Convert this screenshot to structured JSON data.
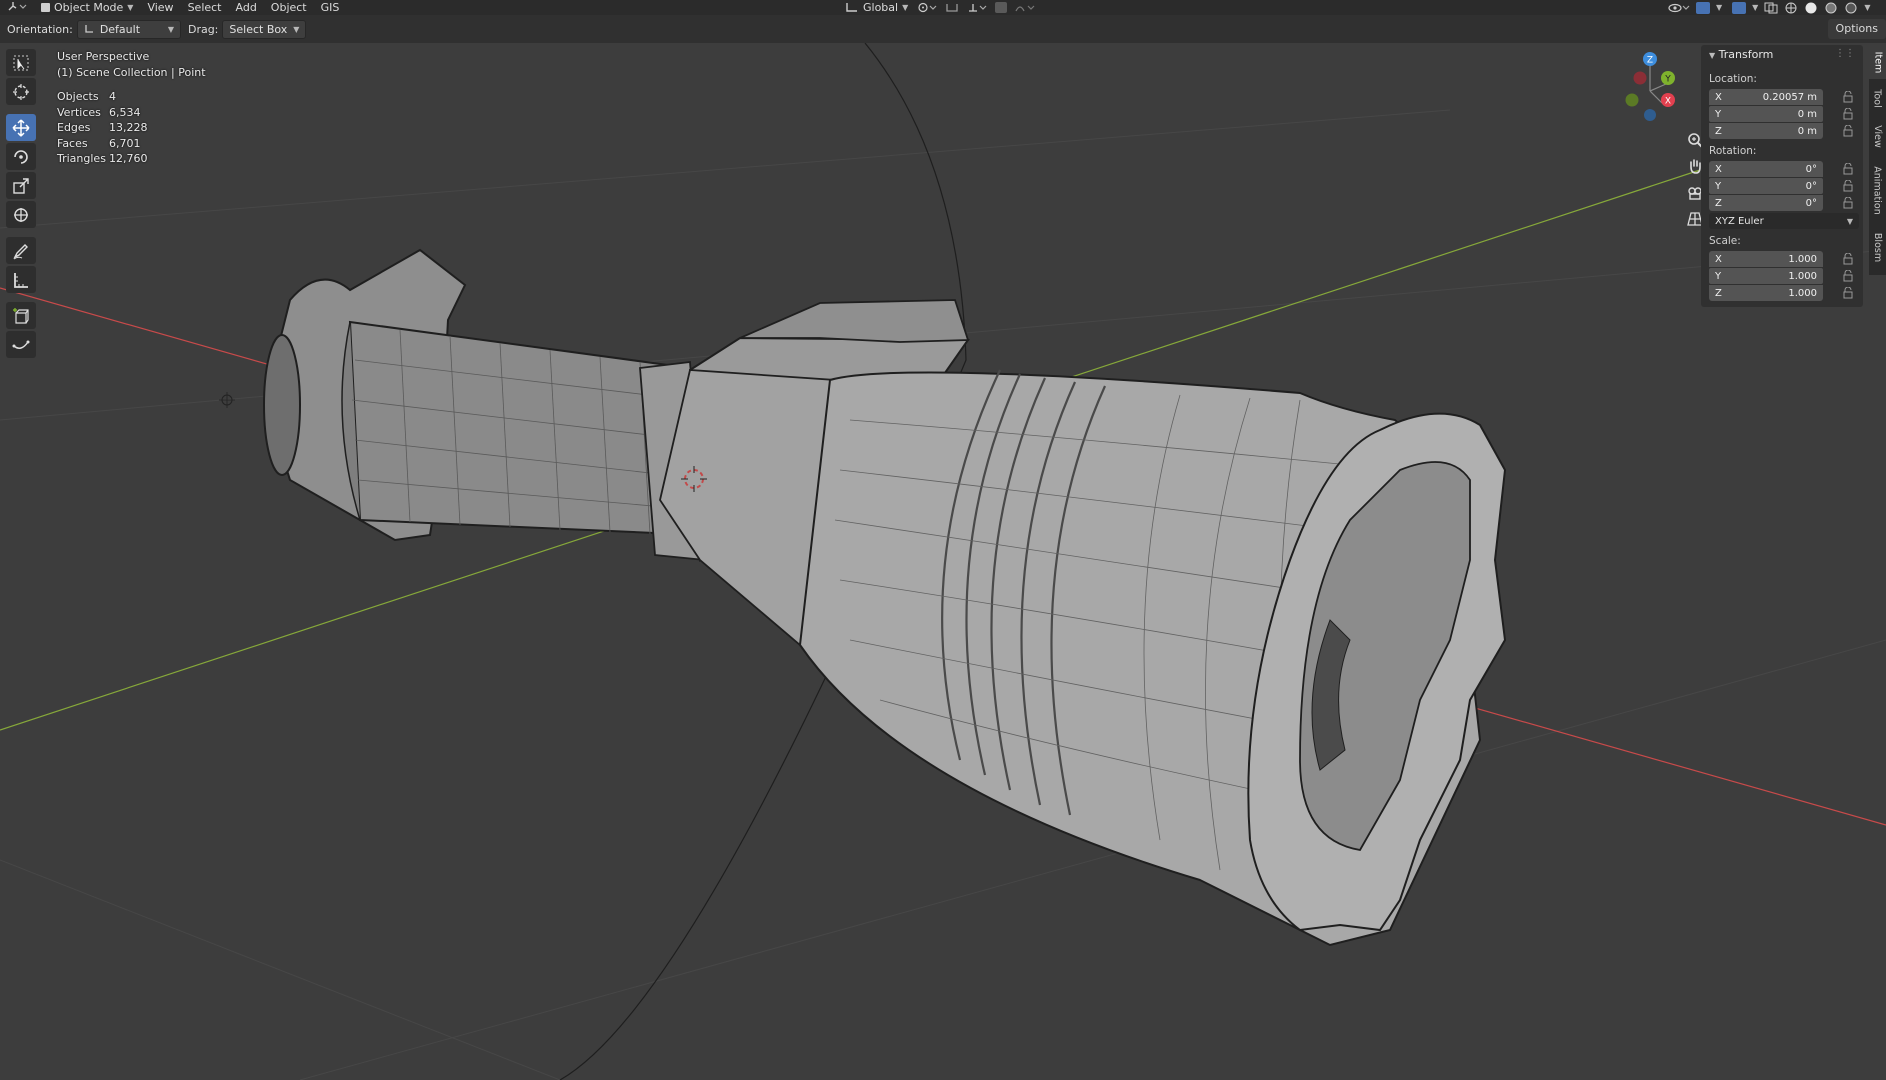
{
  "header": {
    "mode": "Object Mode",
    "menus": [
      "View",
      "Select",
      "Add",
      "Object",
      "GIS"
    ],
    "transform_orientation": "Global"
  },
  "tool_settings": {
    "orientation_label": "Orientation:",
    "orientation_value": "Default",
    "drag_label": "Drag:",
    "drag_value": "Select Box",
    "options_label": "Options"
  },
  "viewport": {
    "perspective": "User Perspective",
    "collection": "(1) Scene Collection | Point",
    "stats": [
      {
        "key": "Objects",
        "value": "4"
      },
      {
        "key": "Vertices",
        "value": "6,534"
      },
      {
        "key": "Edges",
        "value": "13,228"
      },
      {
        "key": "Faces",
        "value": "6,701"
      },
      {
        "key": "Triangles",
        "value": "12,760"
      }
    ],
    "gizmo": {
      "x": "X",
      "y": "Y",
      "z": "Z"
    }
  },
  "toolbar_icons": [
    "select-box-icon",
    "cursor-icon",
    "move-icon",
    "rotate-icon",
    "scale-icon",
    "transform-icon",
    "annotate-icon",
    "measure-icon",
    "add-cube-icon",
    "extrude-curve-icon"
  ],
  "transform_panel": {
    "title": "Transform",
    "location_label": "Location:",
    "location": [
      {
        "axis": "X",
        "value": "0.20057 m"
      },
      {
        "axis": "Y",
        "value": "0 m"
      },
      {
        "axis": "Z",
        "value": "0 m"
      }
    ],
    "rotation_label": "Rotation:",
    "rotation": [
      {
        "axis": "X",
        "value": "0°"
      },
      {
        "axis": "Y",
        "value": "0°"
      },
      {
        "axis": "Z",
        "value": "0°"
      }
    ],
    "rotation_mode": "XYZ Euler",
    "scale_label": "Scale:",
    "scale": [
      {
        "axis": "X",
        "value": "1.000"
      },
      {
        "axis": "Y",
        "value": "1.000"
      },
      {
        "axis": "Z",
        "value": "1.000"
      }
    ]
  },
  "side_tabs": [
    "Item",
    "Tool",
    "View",
    "Animation",
    "Blosm"
  ],
  "colors": {
    "axis_x": "#c84a4a",
    "axis_y": "#86a83a",
    "active_tool": "#4772b3",
    "gizmo_x": "#e2404f",
    "gizmo_y": "#7fb22d",
    "gizmo_z": "#3e8ede"
  }
}
